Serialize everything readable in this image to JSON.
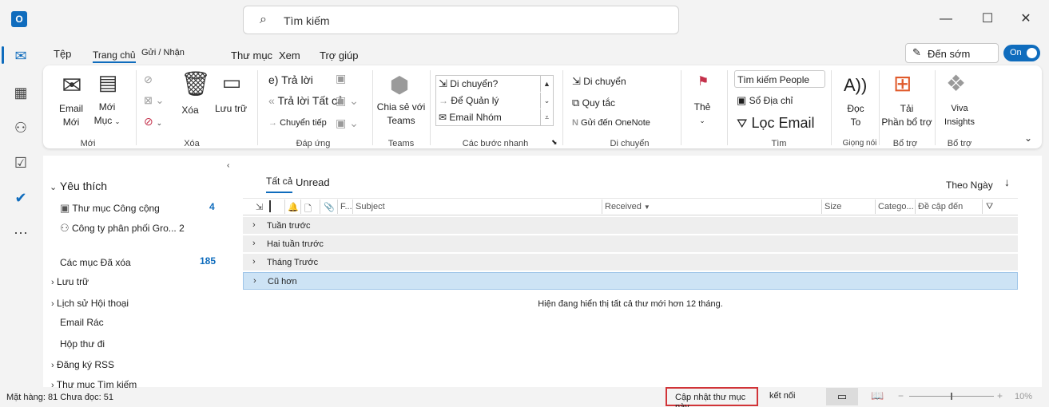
{
  "app": {
    "icon_letter": "O"
  },
  "search": {
    "placeholder": "Tìm kiếm"
  },
  "menu": {
    "file": "Tệp",
    "home": "Trang chủ",
    "send_receive": "Gửi / Nhận",
    "folder": "Thư mục",
    "view": "Xem",
    "help": "Trợ giúp"
  },
  "early": {
    "label": "Đến sớm"
  },
  "toggle": {
    "label": "On",
    "state": "on"
  },
  "ribbon": {
    "new": {
      "email_line1": "Email",
      "email_line2": "Mới",
      "items_line1": "Mới",
      "items_line2": "Mục",
      "group": "Mới"
    },
    "delete": {
      "delete_label": "Xóa",
      "archive_label": "Lưu trữ",
      "group": "Xóa"
    },
    "respond": {
      "reply": "Trả lời",
      "reply_all": "Trả lời Tất cả",
      "forward": "Chuyển tiếp",
      "group": "Đáp ứng"
    },
    "teams": {
      "share_line1": "Chia sẻ với",
      "share_line2": "Teams",
      "group": "Teams"
    },
    "quick_steps": {
      "items": [
        "Di chuyển?",
        "Để Quản lý",
        "Email Nhóm"
      ],
      "group": "Các bước nhanh"
    },
    "move": {
      "move": "Di chuyển",
      "rules": "Quy tắc",
      "onenote": "Gửi đến OneNote",
      "group": "Di chuyển"
    },
    "tags": {
      "label": "Thẻ"
    },
    "find": {
      "search_people": "Tìm kiếm People",
      "address_book": "Sổ Địa chỉ",
      "filter_email": "Lọc Email",
      "group": "Tìm"
    },
    "voice": {
      "read_line1": "Đọc",
      "read_line2": "To",
      "group": "Giọng nói",
      "icon_text": "A))"
    },
    "addins": {
      "get_line1": "Tải",
      "get_line2": "Phần bổ trợ",
      "group": "Bổ trợ"
    },
    "viva": {
      "line1": "Viva",
      "line2": "Insights",
      "group": "Bổ trợ"
    }
  },
  "folders": {
    "favorites": "Yêu thích",
    "items": [
      {
        "label": "Thư mục Công cộng",
        "count": "4"
      },
      {
        "label": "Công ty phân phối Gro...",
        "count": "2"
      },
      {
        "label": "Các mục Đã xóa",
        "count": "185"
      },
      {
        "label": "Lưu trữ"
      },
      {
        "label": "Lịch sử Hội thoại"
      },
      {
        "label": "Email Rác"
      },
      {
        "label": "Hộp thư đi"
      },
      {
        "label": "Đăng ký RSS"
      },
      {
        "label": "Thư mục Tìm kiếm"
      }
    ]
  },
  "message_list": {
    "tab_all": "Tất cả",
    "tab_unread": "Unread",
    "sort_by": "Theo Ngày",
    "columns": {
      "from": "F...",
      "subject": "Subject",
      "received": "Received",
      "size": "Size",
      "categories": "Catego...",
      "mentioned": "Đề cập đến"
    },
    "groups": [
      "Tuần trước",
      "Hai tuần trước",
      "Tháng Trước",
      "Cũ hơn"
    ],
    "note": "Hiện đang hiển thị tất cả thư mới hơn 12 tháng."
  },
  "status": {
    "items": "Mặt hàng: 81",
    "unread": "Chưa đọc: 51",
    "update_folder": "Cập nhật thư mục này",
    "connected": "kết nối",
    "zoom": "10%"
  }
}
